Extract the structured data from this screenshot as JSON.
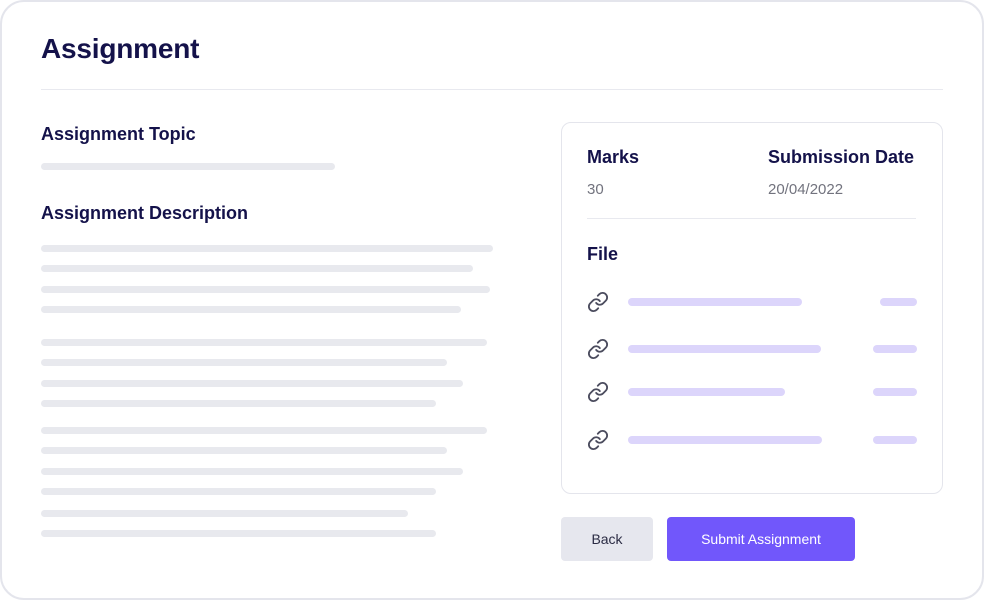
{
  "page": {
    "title": "Assignment"
  },
  "left": {
    "topic_label": "Assignment Topic",
    "description_label": "Assignment Description"
  },
  "info": {
    "marks_label": "Marks",
    "marks_value": "30",
    "submission_date_label": "Submission Date",
    "submission_date_value": "20/04/2022",
    "file_label": "File",
    "files": [
      {
        "icon": "link-icon"
      },
      {
        "icon": "link-icon"
      },
      {
        "icon": "link-icon"
      },
      {
        "icon": "link-icon"
      }
    ]
  },
  "actions": {
    "back_label": "Back",
    "submit_label": "Submit Assignment"
  },
  "colors": {
    "heading": "#14124a",
    "accent": "#7157fb",
    "placeholder_line": "#e8e9ee",
    "file_placeholder": "#dcd5fb"
  }
}
